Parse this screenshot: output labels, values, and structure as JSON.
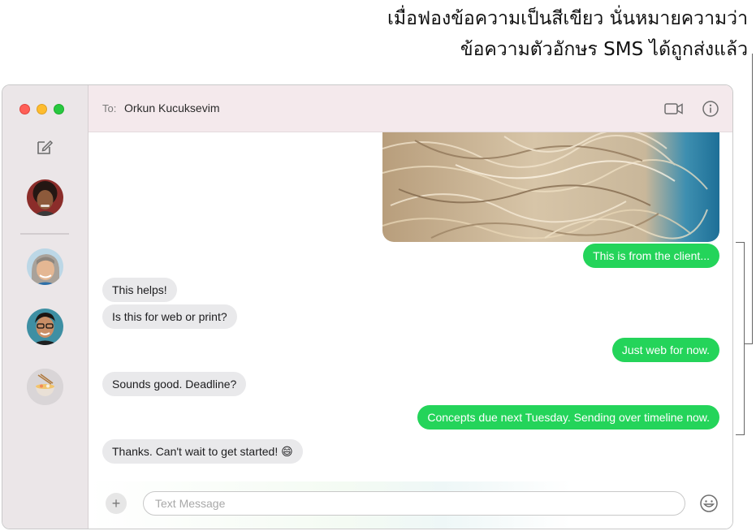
{
  "callout": {
    "line1": "เมื่อฟองข้อความเป็นสีเขียว นั่นหมายความว่า",
    "line2": "ข้อความตัวอักษร SMS ได้ถูกส่งแล้ว"
  },
  "header": {
    "to_label": "To:",
    "recipient": "Orkun Kucuksevim"
  },
  "messages": [
    {
      "direction": "out",
      "text": "This is from the client..."
    },
    {
      "direction": "in",
      "text": "This helps!"
    },
    {
      "direction": "in",
      "text": "Is this for web or print?"
    },
    {
      "direction": "out",
      "text": "Just web for now."
    },
    {
      "direction": "in",
      "text": "Sounds good. Deadline?"
    },
    {
      "direction": "out",
      "text": "Concepts due next Tuesday. Sending over timeline now."
    },
    {
      "direction": "in",
      "text": "Thanks. Can't wait to get started! 😄"
    }
  ],
  "composer": {
    "placeholder": "Text Message",
    "value": ""
  },
  "colors": {
    "sms_bubble": "#24d45a",
    "received_bubble": "#e9e9eb"
  },
  "icons": {
    "compose": "compose-icon",
    "video": "video-camera-icon",
    "info": "info-icon",
    "add": "plus-icon",
    "emoji": "smiley-icon"
  }
}
